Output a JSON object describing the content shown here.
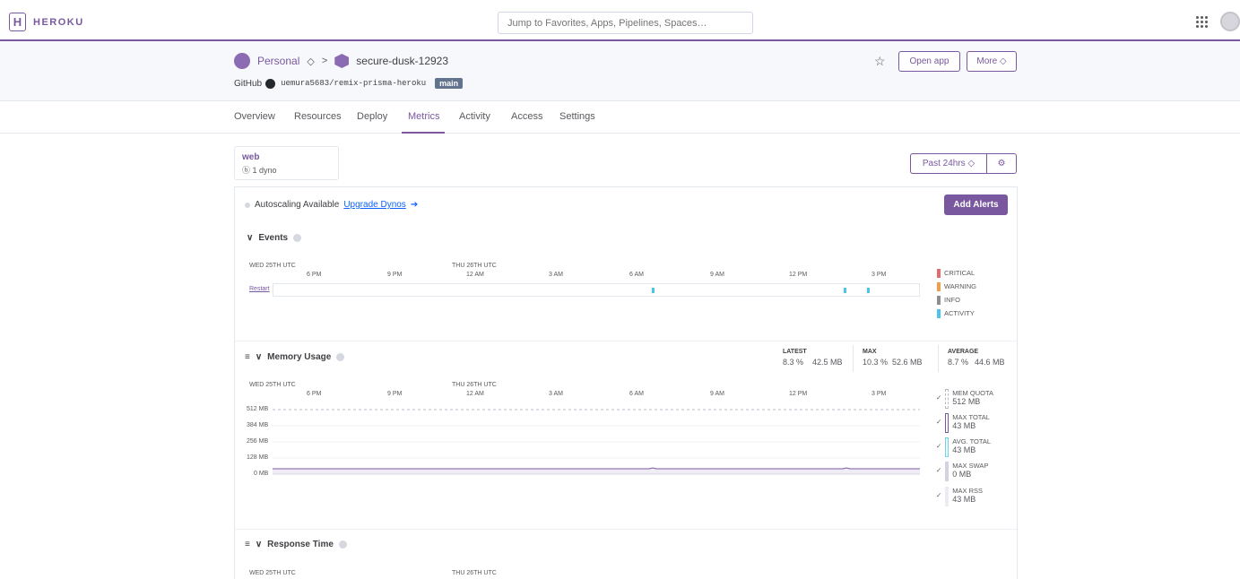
{
  "topbar": {
    "logo_letter": "H",
    "logo_text": "HEROKU",
    "search_placeholder": "Jump to Favorites, Apps, Pipelines, Spaces…"
  },
  "header": {
    "account": "Personal",
    "account_chevron": "◇",
    "separator": ">",
    "app_name": "secure-dusk-12923",
    "github_label": "GitHub",
    "repo": "uemura5683/remix-prisma-heroku",
    "branch": "main",
    "open_app": "Open app",
    "more": "More ◇",
    "star": "☆"
  },
  "tabs": [
    "Overview",
    "Resources",
    "Deploy",
    "Metrics",
    "Activity",
    "Access",
    "Settings"
  ],
  "active_tab": "Metrics",
  "dyno": {
    "name": "web",
    "count": "1 dyno"
  },
  "timerange": {
    "label": "Past 24hrs ◇",
    "gear": "⚙"
  },
  "autoscaling": {
    "text": "Autoscaling Available",
    "link": "Upgrade Dynos",
    "link_icon": "➔"
  },
  "add_alerts": "Add Alerts",
  "timeline": {
    "day1": "WED 25TH UTC",
    "day2": "THU 26TH UTC",
    "ticks": [
      "6 PM",
      "9 PM",
      "12 AM",
      "3 AM",
      "6 AM",
      "9 AM",
      "12 PM",
      "3 PM"
    ]
  },
  "events": {
    "title": "Events",
    "chevron": "∨",
    "row_label": "Restart",
    "legend": [
      {
        "label": "CRITICAL",
        "color": "#e46b6b"
      },
      {
        "label": "WARNING",
        "color": "#f29d49"
      },
      {
        "label": "INFO",
        "color": "#8d8d92"
      },
      {
        "label": "ACTIVITY",
        "color": "#4fc3e8"
      }
    ]
  },
  "memory": {
    "title": "Memory Usage",
    "chevron": "∨",
    "menu": "≡",
    "stats": {
      "latest_label": "LATEST",
      "latest_pct": "8.3 %",
      "latest_mb": "42.5 MB",
      "max_label": "MAX",
      "max_pct": "10.3 %",
      "max_mb": "52.6 MB",
      "avg_label": "AVERAGE",
      "avg_pct": "8.7 %",
      "avg_mb": "44.6 MB"
    },
    "y_labels": [
      "512 MB",
      "384 MB",
      "256 MB",
      "128 MB",
      "0 MB"
    ],
    "legend": [
      {
        "label": "MEM QUOTA",
        "value": "512 MB"
      },
      {
        "label": "MAX TOTAL",
        "value": "43 MB"
      },
      {
        "label": "AVG. TOTAL",
        "value": "43 MB"
      },
      {
        "label": "MAX SWAP",
        "value": "0 MB"
      },
      {
        "label": "MAX RSS",
        "value": "43 MB"
      }
    ],
    "check": "✓"
  },
  "response": {
    "title": "Response Time",
    "chevron": "∨",
    "menu": "≡",
    "day1": "WED 25TH UTC",
    "day2": "THU 26TH UTC"
  }
}
